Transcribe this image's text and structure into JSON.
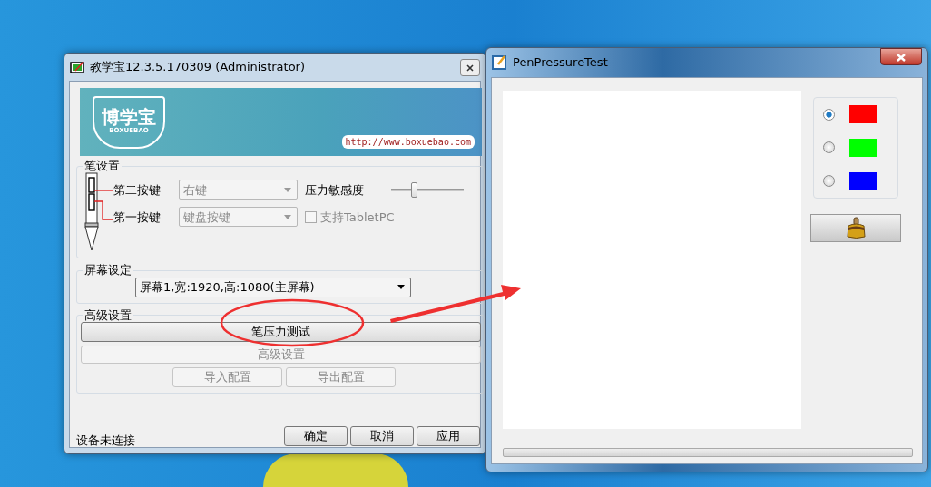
{
  "main_window": {
    "title": "教学宝12.3.5.170309 (Administrator)",
    "banner": {
      "logo_text": "博学宝",
      "logo_subtext": "BOXUEBAO",
      "url": "http://www.boxuebao.com"
    },
    "pen_settings": {
      "title": "笔设置",
      "buttons": [
        {
          "label": "第二按键",
          "value": "右键",
          "disabled": true
        },
        {
          "label": "第一按键",
          "value": "键盘按键",
          "disabled": true
        }
      ],
      "pressure_label": "压力敏感度",
      "pressure_slider": {
        "level": 0.3
      },
      "tablet_pc": {
        "label": "支持TabletPC",
        "checked": false,
        "disabled": true
      }
    },
    "screen_settings": {
      "title": "屏幕设定",
      "screen": "屏幕1,宽:1920,高:1080(主屏幕)"
    },
    "advanced_settings": {
      "title": "高级设置",
      "buttons": [
        {
          "label": "笔压力测试",
          "disabled": false
        },
        {
          "label": "高级设置",
          "disabled": true
        }
      ],
      "config_buttons": [
        {
          "label": "导入配置",
          "disabled": true
        },
        {
          "label": "导出配置",
          "disabled": true
        }
      ]
    },
    "status": "设备未连接",
    "buttons": [
      "确定",
      "取消",
      "应用"
    ]
  },
  "test_window": {
    "title": "PenPressureTest",
    "colors": [
      {
        "color": "#ff0000",
        "selected": true
      },
      {
        "color": "#00ff00",
        "selected": false
      },
      {
        "color": "#0000ff",
        "selected": false
      }
    ]
  }
}
